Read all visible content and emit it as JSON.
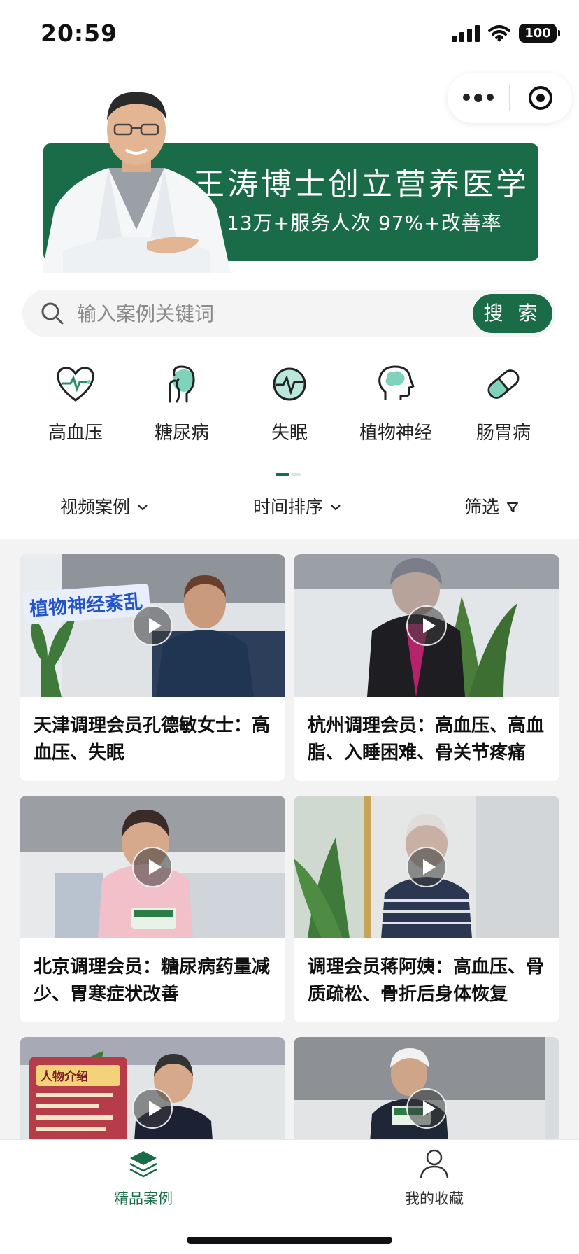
{
  "status_bar": {
    "time": "20:59",
    "battery": "100"
  },
  "banner": {
    "title": "王涛博士创立营养医学",
    "subtitle": "13万+服务人次  97%+改善率"
  },
  "search": {
    "placeholder": "输入案例关键词",
    "button": "搜 索"
  },
  "categories": [
    {
      "label": "高血压",
      "icon": "heart-pulse-icon"
    },
    {
      "label": "糖尿病",
      "icon": "pancreas-icon"
    },
    {
      "label": "失眠",
      "icon": "pulse-circle-icon"
    },
    {
      "label": "植物神经",
      "icon": "head-brain-icon"
    },
    {
      "label": "肠胃病",
      "icon": "capsule-pill-icon"
    }
  ],
  "filters": {
    "type": "视频案例",
    "sort": "时间排序",
    "filter": "筛选"
  },
  "cases": [
    {
      "title": "天津调理会员孔德敏女士：高血压、失眠",
      "overlay": "植物神经紊乱"
    },
    {
      "title": "杭州调理会员：高血压、高血脂、入睡困难、骨关节疼痛"
    },
    {
      "title": "北京调理会员：糖尿病药量减少、胃寒症状改善"
    },
    {
      "title": "调理会员蒋阿姨：高血压、骨质疏松、骨折后身体恢复"
    },
    {
      "title": "",
      "overlay": "人物介绍"
    },
    {
      "title": ""
    }
  ],
  "tabbar": {
    "items": [
      {
        "label": "精品案例",
        "active": true
      },
      {
        "label": "我的收藏",
        "active": false
      }
    ]
  },
  "colors": {
    "brand": "#1a6b48",
    "grid_bg": "#f2f3f2"
  }
}
